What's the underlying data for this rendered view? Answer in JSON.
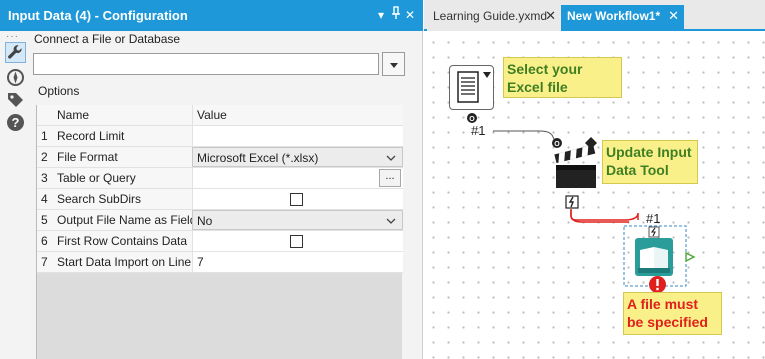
{
  "window": {
    "panel_title": "Input Data (4) - Configuration",
    "title_controls": [
      "▾",
      "▮",
      "✕"
    ]
  },
  "config": {
    "connect_label": "Connect a File or Database",
    "connect_value": "",
    "options_label": "Options",
    "grid": {
      "headers": {
        "name": "Name",
        "value": "Value"
      },
      "rows": [
        {
          "num": "1",
          "name": "Record Limit",
          "value": ""
        },
        {
          "num": "2",
          "name": "File Format",
          "value": "Microsoft Excel (*.xlsx)"
        },
        {
          "num": "3",
          "name": "Table or Query",
          "value": "",
          "button": "..."
        },
        {
          "num": "4",
          "name": "Search SubDirs",
          "checked": false
        },
        {
          "num": "5",
          "name": "Output File Name as Field",
          "value": "No"
        },
        {
          "num": "6",
          "name": "First Row Contains Data",
          "checked": false
        },
        {
          "num": "7",
          "name": "Start Data Import on Line",
          "value": "7"
        }
      ]
    }
  },
  "tabs": [
    {
      "label": "Learning Guide.yxmd",
      "close": "✕",
      "active": false
    },
    {
      "label": "New Workflow1*",
      "close": "✕",
      "active": true
    }
  ],
  "canvas": {
    "notes": {
      "select": "Select your Excel file",
      "update": "Update Input Data Tool",
      "error": "A file must be specified"
    },
    "connections": {
      "first": "#1",
      "second": "#1"
    }
  },
  "colors": {
    "accent": "#1e98d8",
    "note_bg": "#faf08a",
    "note_text_green": "#3f7f24",
    "error_red": "#e0201c",
    "input_tool_teal": "#2a9d9b",
    "wire_red": "#e0201c"
  },
  "icons": {
    "toolstrip": [
      "wrench-icon",
      "compass-icon",
      "tag-icon",
      "help-icon"
    ],
    "tools": [
      "input-file-icon",
      "clapperboard-icon",
      "book-icon",
      "error-icon"
    ]
  }
}
